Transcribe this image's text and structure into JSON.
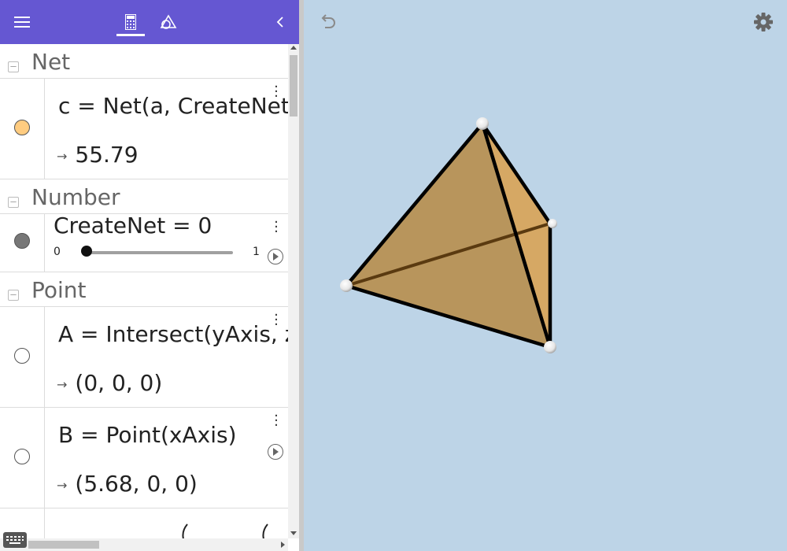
{
  "header": {
    "menu_icon": "hamburger-menu-icon",
    "views": [
      {
        "name": "algebra",
        "icon": "calculator-icon",
        "active": true
      },
      {
        "name": "tools",
        "icon": "geometry-tools-icon",
        "active": false
      }
    ],
    "collapse_icon": "chevron-left-icon",
    "accent_color": "#6557d2"
  },
  "algebra": {
    "groups": [
      {
        "title": "Net"
      },
      {
        "title": "Number"
      },
      {
        "title": "Point"
      }
    ],
    "items": [
      {
        "definition": "c = Net(a, CreateNet",
        "value": "55.79",
        "marble_color": "#ffcc80"
      },
      {
        "definition": "CreateNet = 0",
        "slider_min": "0",
        "slider_max": "1",
        "slider_value": 0,
        "marble_color": "#777777"
      },
      {
        "definition": "A = Intersect(yAxis, z",
        "value": "(0,  0,  0)",
        "marble_color": "#ffffff"
      },
      {
        "definition": "B = Point(xAxis)",
        "value": "(5.68,  0,  0)",
        "marble_color": "#ffffff"
      }
    ],
    "arrow": "→"
  },
  "graphics": {
    "background": "#bdd4e7",
    "undo_icon": "undo-icon",
    "settings_icon": "gear-icon",
    "solid_color": "#b8955c",
    "solid_light_color": "#d6a864"
  }
}
